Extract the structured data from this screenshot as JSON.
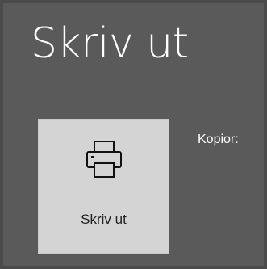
{
  "header": {
    "title": "Skriv ut"
  },
  "print_button": {
    "label": "Skriv ut",
    "icon": "printer-icon"
  },
  "copies": {
    "label": "Kopior:"
  },
  "colors": {
    "background": "#5a5a5a",
    "button_background": "#d4d4d4"
  }
}
